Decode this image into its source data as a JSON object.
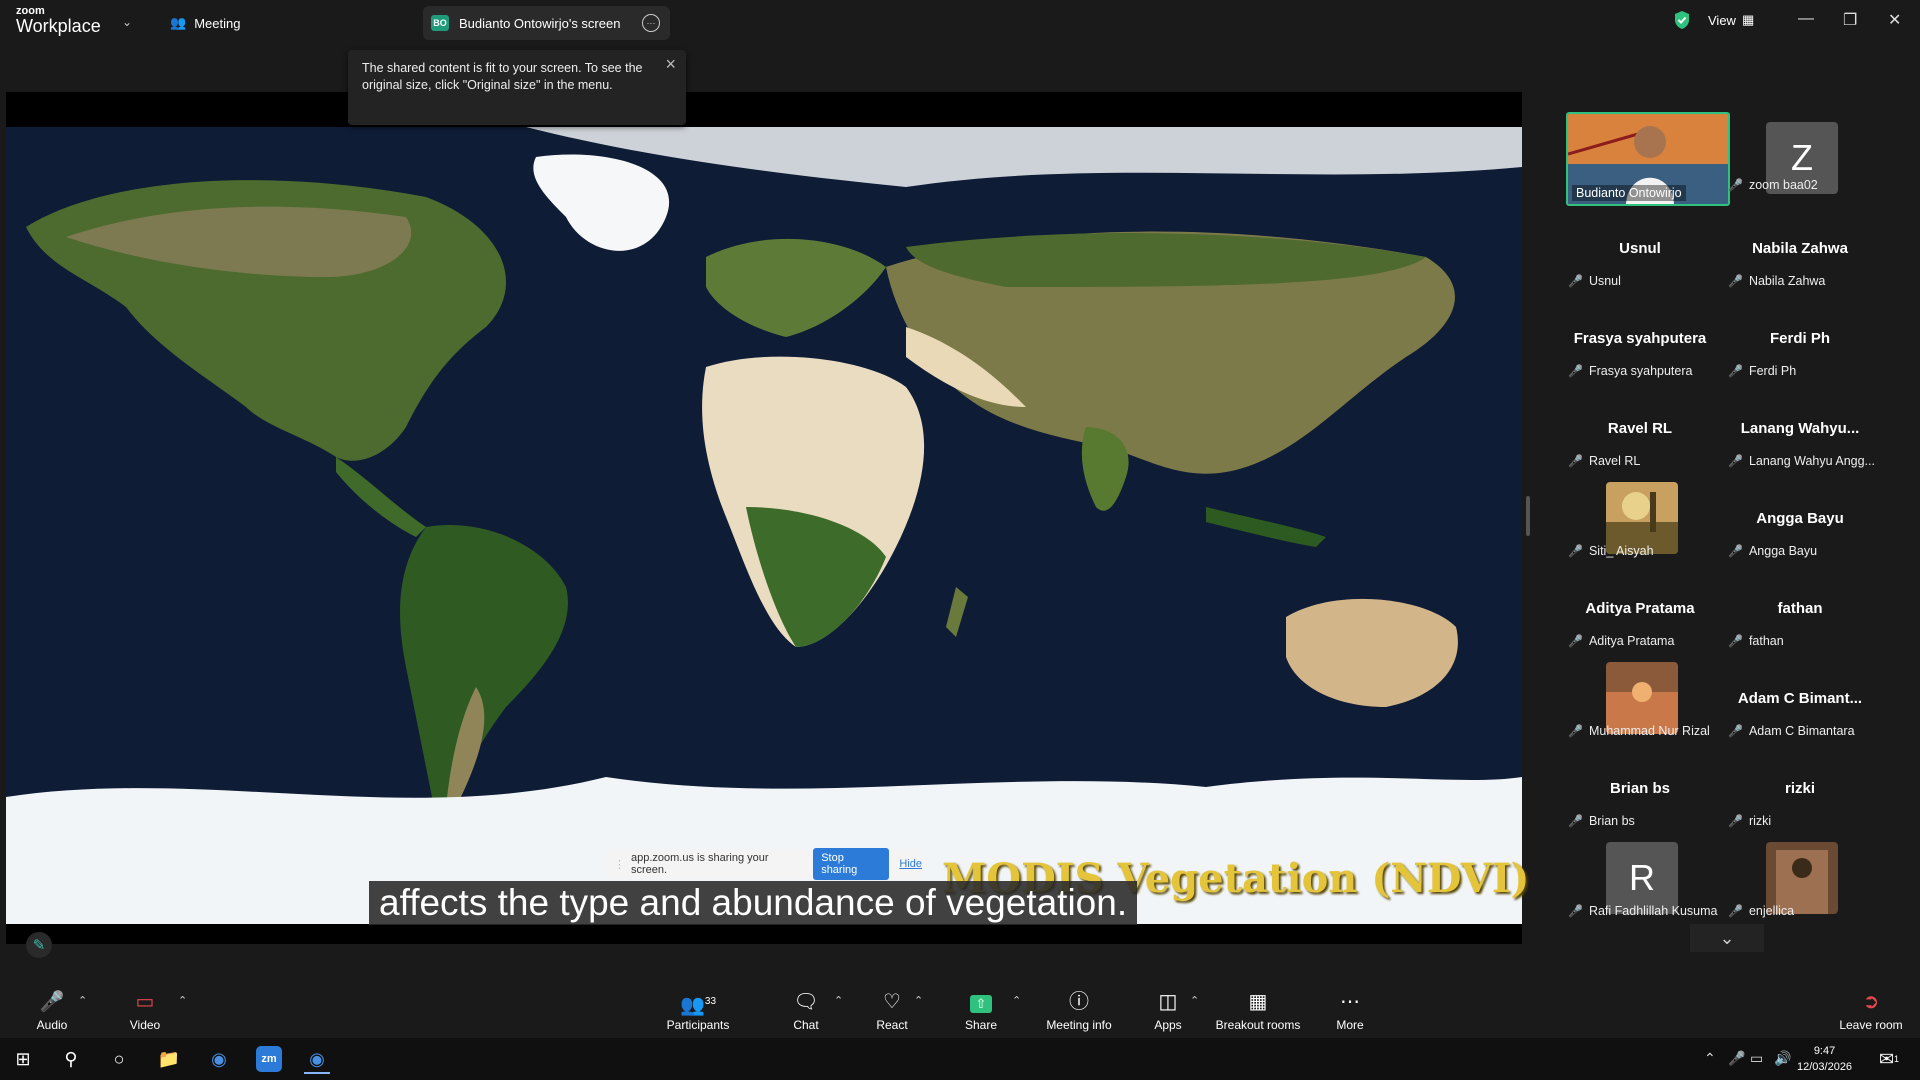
{
  "app": {
    "brand_top": "zoom",
    "brand_bottom": "Workplace",
    "meeting_label": "Meeting",
    "view_label": "View"
  },
  "share_tab": {
    "badge": "BO",
    "title": "Budianto Ontowirjo's screen"
  },
  "toast": {
    "message": "The shared content is fit to your screen. To see the original size, click \"Original size\" in the menu."
  },
  "screen": {
    "sharing_notice": "app.zoom.us is sharing your screen.",
    "stop_sharing": "Stop sharing",
    "hide": "Hide",
    "slide_title": "MODIS Vegetation (NDVI)",
    "caption": "affects the type and abundance of vegetation."
  },
  "participants": {
    "active": {
      "name": "Budianto Ontowirjo"
    },
    "tiles": [
      {
        "display": "",
        "label": "zoom baa02",
        "letter": "Z"
      },
      {
        "display": "Usnul",
        "label": "Usnul"
      },
      {
        "display": "Nabila Zahwa",
        "label": "Nabila Zahwa"
      },
      {
        "display": "Frasya syahputera",
        "label": "Frasya syahputera"
      },
      {
        "display": "Ferdi Ph",
        "label": "Ferdi Ph"
      },
      {
        "display": "Ravel RL",
        "label": "Ravel RL"
      },
      {
        "display": "Lanang  Wahyu...",
        "label": "Lanang Wahyu Angg..."
      },
      {
        "display": "",
        "label": "Siti_ Aisyah"
      },
      {
        "display": "Angga Bayu",
        "label": "Angga Bayu"
      },
      {
        "display": "Aditya Pratama",
        "label": "Aditya Pratama"
      },
      {
        "display": "fathan",
        "label": "fathan"
      },
      {
        "display": "",
        "label": "Muhammad Nur Rizal"
      },
      {
        "display": "Adam C Bimant...",
        "label": "Adam C Bimantara"
      },
      {
        "display": "Brian bs",
        "label": "Brian bs"
      },
      {
        "display": "rizki",
        "label": "rizki"
      },
      {
        "display": "",
        "label": "Rafi Fadhlillah Kusuma",
        "letter": "R"
      },
      {
        "display": "",
        "label": "enjellica"
      }
    ]
  },
  "toolbar": {
    "audio": "Audio",
    "video": "Video",
    "participants": "Participants",
    "participants_count": "33",
    "chat": "Chat",
    "react": "React",
    "share": "Share",
    "meeting_info": "Meeting info",
    "apps": "Apps",
    "breakout": "Breakout rooms",
    "more": "More",
    "leave": "Leave room"
  },
  "taskbar": {
    "time": "9:47",
    "date": "12/03/2026",
    "notif_count": "1"
  }
}
